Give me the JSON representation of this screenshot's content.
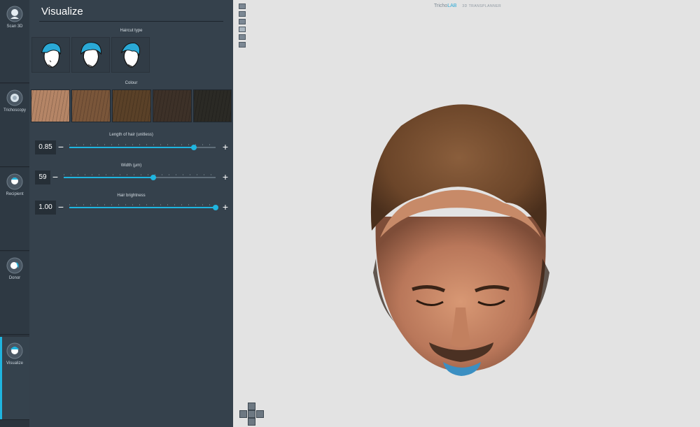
{
  "nav": {
    "items": [
      {
        "label": "Scan 3D",
        "icon": "head-scan-icon"
      },
      {
        "label": "Trichoscopy",
        "icon": "trichoscopy-icon"
      },
      {
        "label": "Recipient",
        "icon": "recipient-icon"
      },
      {
        "label": "Donor",
        "icon": "donor-icon"
      },
      {
        "label": "Visualize",
        "icon": "visualize-icon",
        "active": true
      }
    ]
  },
  "panel": {
    "title": "Visualize",
    "haircut_label": "Haircut type",
    "haircut_options": [
      "haircut-short-icon",
      "haircut-medium-icon",
      "haircut-long-icon"
    ],
    "colour_label": "Colour",
    "colours": [
      "#b58566",
      "#7a563a",
      "#5a4128",
      "#3d3128",
      "#2b2a25"
    ],
    "sliders": [
      {
        "label": "Length of hair (unitless)",
        "value": "0.85",
        "fraction": 0.85
      },
      {
        "label": "Width (μm)",
        "value": "59",
        "fraction": 0.59
      },
      {
        "label": "Hair brightness",
        "value": "1.00",
        "fraction": 1.0
      }
    ]
  },
  "viewport": {
    "brand_prefix": "Tricho",
    "brand_accent": "LAB",
    "brand_sub": "3D TRANSPLANNER",
    "view_tools": [
      "top-view-icon",
      "head-view-icon",
      "grid-view-icon",
      "hair-view-icon",
      "scalp-view-icon",
      "face-view-icon"
    ],
    "orientation": [
      "orient-up-icon",
      "orient-left-icon",
      "orient-front-icon",
      "orient-right-icon",
      "orient-down-icon"
    ]
  },
  "colors": {
    "accent": "#1fb5e0",
    "panel": "#35414c",
    "rail": "#2b343d",
    "viewport": "#e3e3e3"
  }
}
